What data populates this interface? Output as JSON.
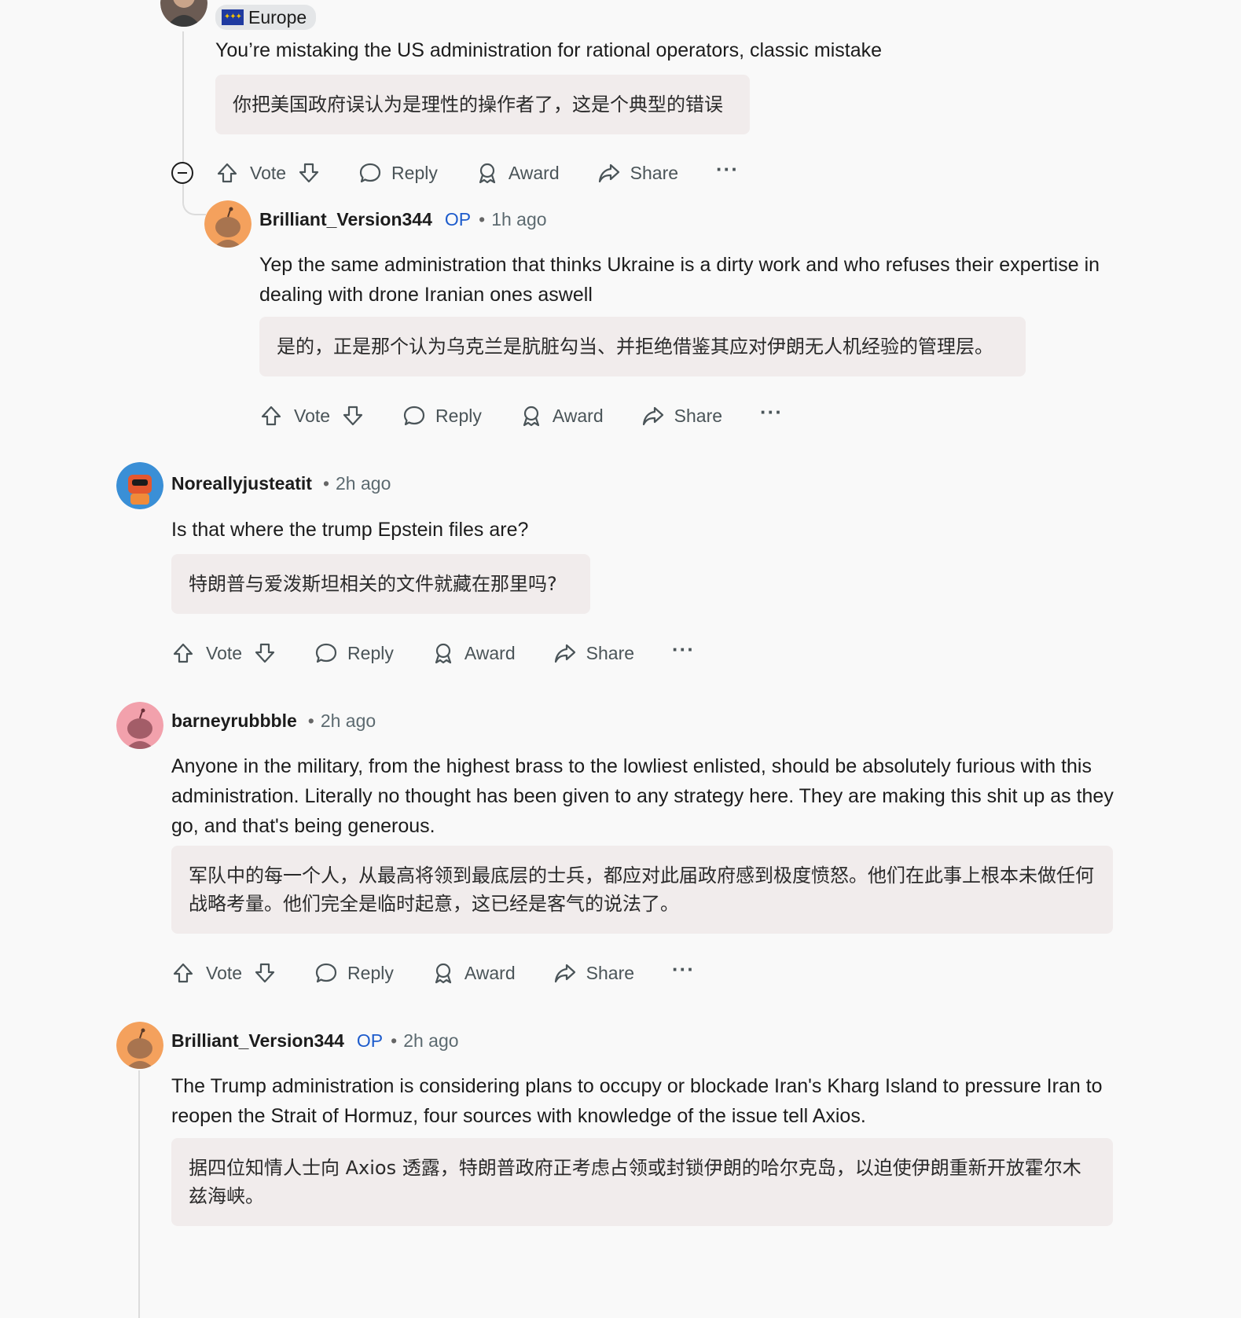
{
  "actions": {
    "vote": "Vote",
    "reply": "Reply",
    "award": "Award",
    "share": "Share",
    "more": "···"
  },
  "comments": [
    {
      "flair": "Europe",
      "body": "You’re mistaking the US administration for rational operators, classic mistake",
      "translation": "你把美国政府误认为是理性的操作者了，这是个典型的错误"
    },
    {
      "username": "Brilliant_Version344",
      "op_badge": "OP",
      "time": "1h ago",
      "body": "Yep the same administration that thinks Ukraine is a dirty work and who refuses their expertise in dealing with drone Iranian ones aswell",
      "translation": "是的，正是那个认为乌克兰是肮脏勾当、并拒绝借鉴其应对伊朗无人机经验的管理层。"
    },
    {
      "username": "Noreallyjusteatit",
      "time": "2h ago",
      "body": "Is that where the trump Epstein files are?",
      "translation": "特朗普与爱泼斯坦相关的文件就藏在那里吗?"
    },
    {
      "username": "barneyrubbble",
      "time": "2h ago",
      "body": "Anyone in the military, from the highest brass to the lowliest enlisted, should be absolutely furious with this administration. Literally no thought has been given to any strategy here. They are making this shit up as they go, and that's being generous.",
      "translation": "军队中的每一个人，从最高将领到最底层的士兵，都应对此届政府感到极度愤怒。他们在此事上根本未做任何战略考量。他们完全是临时起意，这已经是客气的说法了。"
    },
    {
      "username": "Brilliant_Version344",
      "op_badge": "OP",
      "time": "2h ago",
      "body": "The Trump administration is considering plans to occupy or blockade Iran's Kharg Island to pressure Iran to reopen the Strait of Hormuz, four sources with knowledge of the issue tell Axios.",
      "translation": "据四位知情人士向 Axios 透露，特朗普政府正考虑占领或封锁伊朗的哈尔克岛，以迫使伊朗重新开放霍尔木兹海峡。"
    }
  ],
  "icons": {
    "upvote": "arrow-up-icon",
    "downvote": "arrow-down-icon",
    "reply": "speech-bubble-icon",
    "award": "award-ribbon-icon",
    "share": "share-arrow-icon",
    "collapse": "minus-circle-icon"
  },
  "colors": {
    "op": "#1e5ccc",
    "translation_bg": "#f1ecec",
    "avatar_orange": "#f4a15d",
    "avatar_pink": "#f2a1ac"
  }
}
